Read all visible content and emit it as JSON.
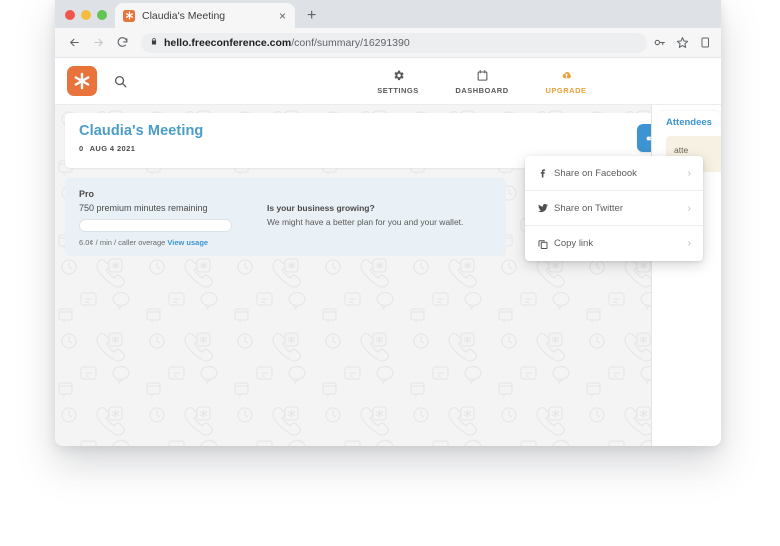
{
  "browser": {
    "tab": {
      "title": "Claudia's Meeting",
      "favicon": "freeconference-logo-icon",
      "close": "×"
    },
    "new_tab_label": "+",
    "nav": {
      "back": "←",
      "forward": "→",
      "reload": "↻"
    },
    "address": {
      "lock_icon": "lock-icon",
      "host": "hello.freeconference.com",
      "path": "/conf/summary/16291390",
      "full_url": "hello.freeconference.com/conf/summary/16291390"
    },
    "omni_actions": [
      "key-icon",
      "star-icon",
      "extensions-icon"
    ],
    "traffic_lights": [
      "close",
      "minimize",
      "maximize"
    ]
  },
  "app": {
    "logo_name": "freeconference-logo",
    "search_icon": "search-icon",
    "nav_items": [
      {
        "label": "SETTINGS",
        "icon": "gear-icon",
        "accent": false
      },
      {
        "label": "DASHBOARD",
        "icon": "calendar-icon",
        "accent": false
      },
      {
        "label": "UPGRADE",
        "icon": "cloud-upload-icon",
        "accent": true
      }
    ]
  },
  "meeting": {
    "title": "Claudia's Meeting",
    "attendee_count": "0",
    "date": "AUG 4 2021",
    "share_button_icon": "share-icon"
  },
  "plan": {
    "name": "Pro",
    "minutes_remaining": "750 premium minutes remaining",
    "progress_percent": 0,
    "overage_rate": "6.0¢ / min / caller overage",
    "view_usage_link": "View usage",
    "upsell_title": "Is your business growing?",
    "upsell_subtitle": "We might have a better plan for you and your wallet."
  },
  "share_menu": {
    "items": [
      {
        "label": "Share on Facebook",
        "icon": "facebook-icon",
        "chevron": "›"
      },
      {
        "label": "Share on Twitter",
        "icon": "twitter-icon",
        "chevron": "›"
      },
      {
        "label": "Copy link",
        "icon": "copy-icon",
        "chevron": "›"
      }
    ]
  },
  "right_panel": {
    "tab_label": "Attendees",
    "invite_card_text": "atte"
  },
  "colors": {
    "brand_orange": "#e8743b",
    "accent_blue": "#3e94d0",
    "title_blue": "#4a9cc9",
    "upgrade_gold": "#e9a23b",
    "panel_blue": "#e9f1f7",
    "page_bg": "#f4f4f5",
    "invite_cream": "#f7f1e3"
  }
}
